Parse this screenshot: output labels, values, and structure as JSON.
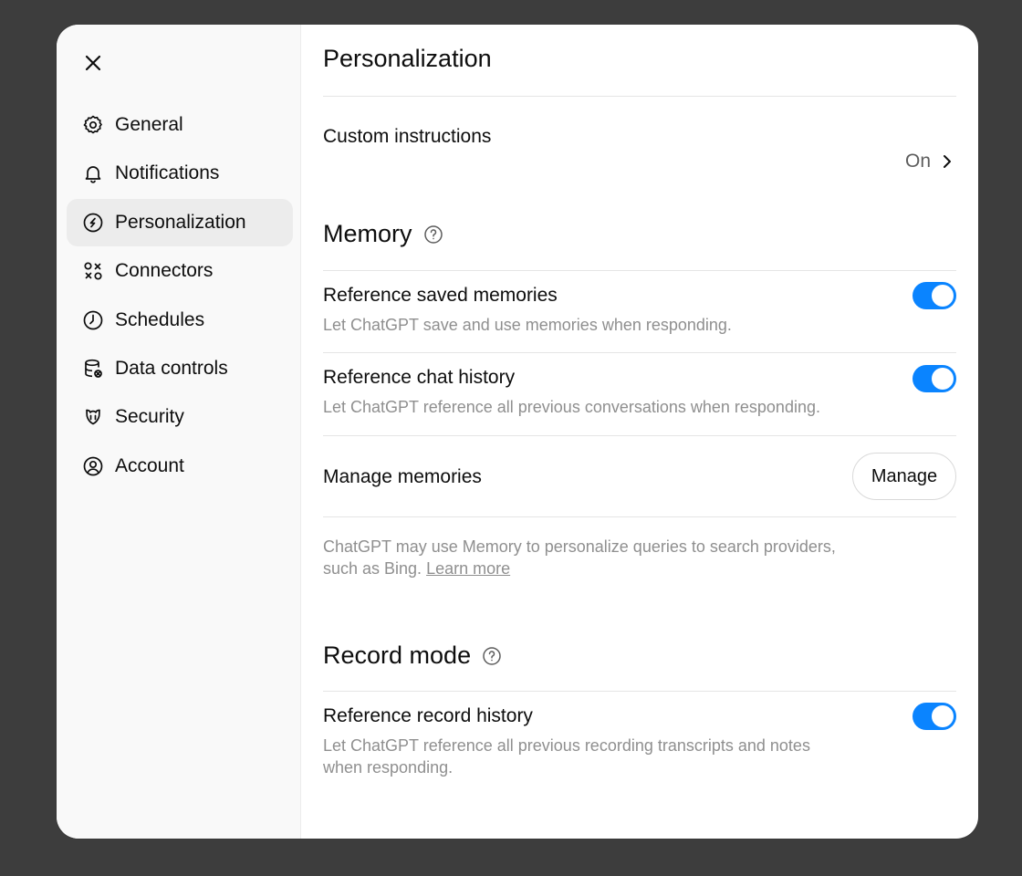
{
  "sidebar": {
    "close_icon": "close-icon",
    "items": [
      {
        "label": "General",
        "icon": "gear-icon"
      },
      {
        "label": "Notifications",
        "icon": "bell-icon"
      },
      {
        "label": "Personalization",
        "icon": "personalization-icon",
        "active": true
      },
      {
        "label": "Connectors",
        "icon": "connectors-icon"
      },
      {
        "label": "Schedules",
        "icon": "clock-icon"
      },
      {
        "label": "Data controls",
        "icon": "database-icon"
      },
      {
        "label": "Security",
        "icon": "shield-icon"
      },
      {
        "label": "Account",
        "icon": "user-circle-icon"
      }
    ]
  },
  "main": {
    "title": "Personalization",
    "custom_instructions": {
      "label": "Custom instructions",
      "value": "On"
    },
    "memory": {
      "title": "Memory",
      "reference_saved": {
        "label": "Reference saved memories",
        "desc": "Let ChatGPT save and use memories when responding.",
        "enabled": true
      },
      "reference_chat": {
        "label": "Reference chat history",
        "desc": "Let ChatGPT reference all previous conversations when responding.",
        "enabled": true
      },
      "manage": {
        "label": "Manage memories",
        "button": "Manage"
      },
      "note_line1": "ChatGPT may use Memory to personalize queries to search providers,",
      "note_line2": "such as Bing.",
      "learn_more": "Learn more"
    },
    "record_mode": {
      "title": "Record mode",
      "reference_record": {
        "label": "Reference record history",
        "desc_line1": "Let ChatGPT reference all previous recording transcripts and notes",
        "desc_line2": "when responding.",
        "enabled": true
      }
    }
  },
  "colors": {
    "accent": "#0a84ff",
    "background": "#3d3d3d",
    "sidebar_bg": "#f9f9f9",
    "active_item_bg": "#ececec"
  }
}
